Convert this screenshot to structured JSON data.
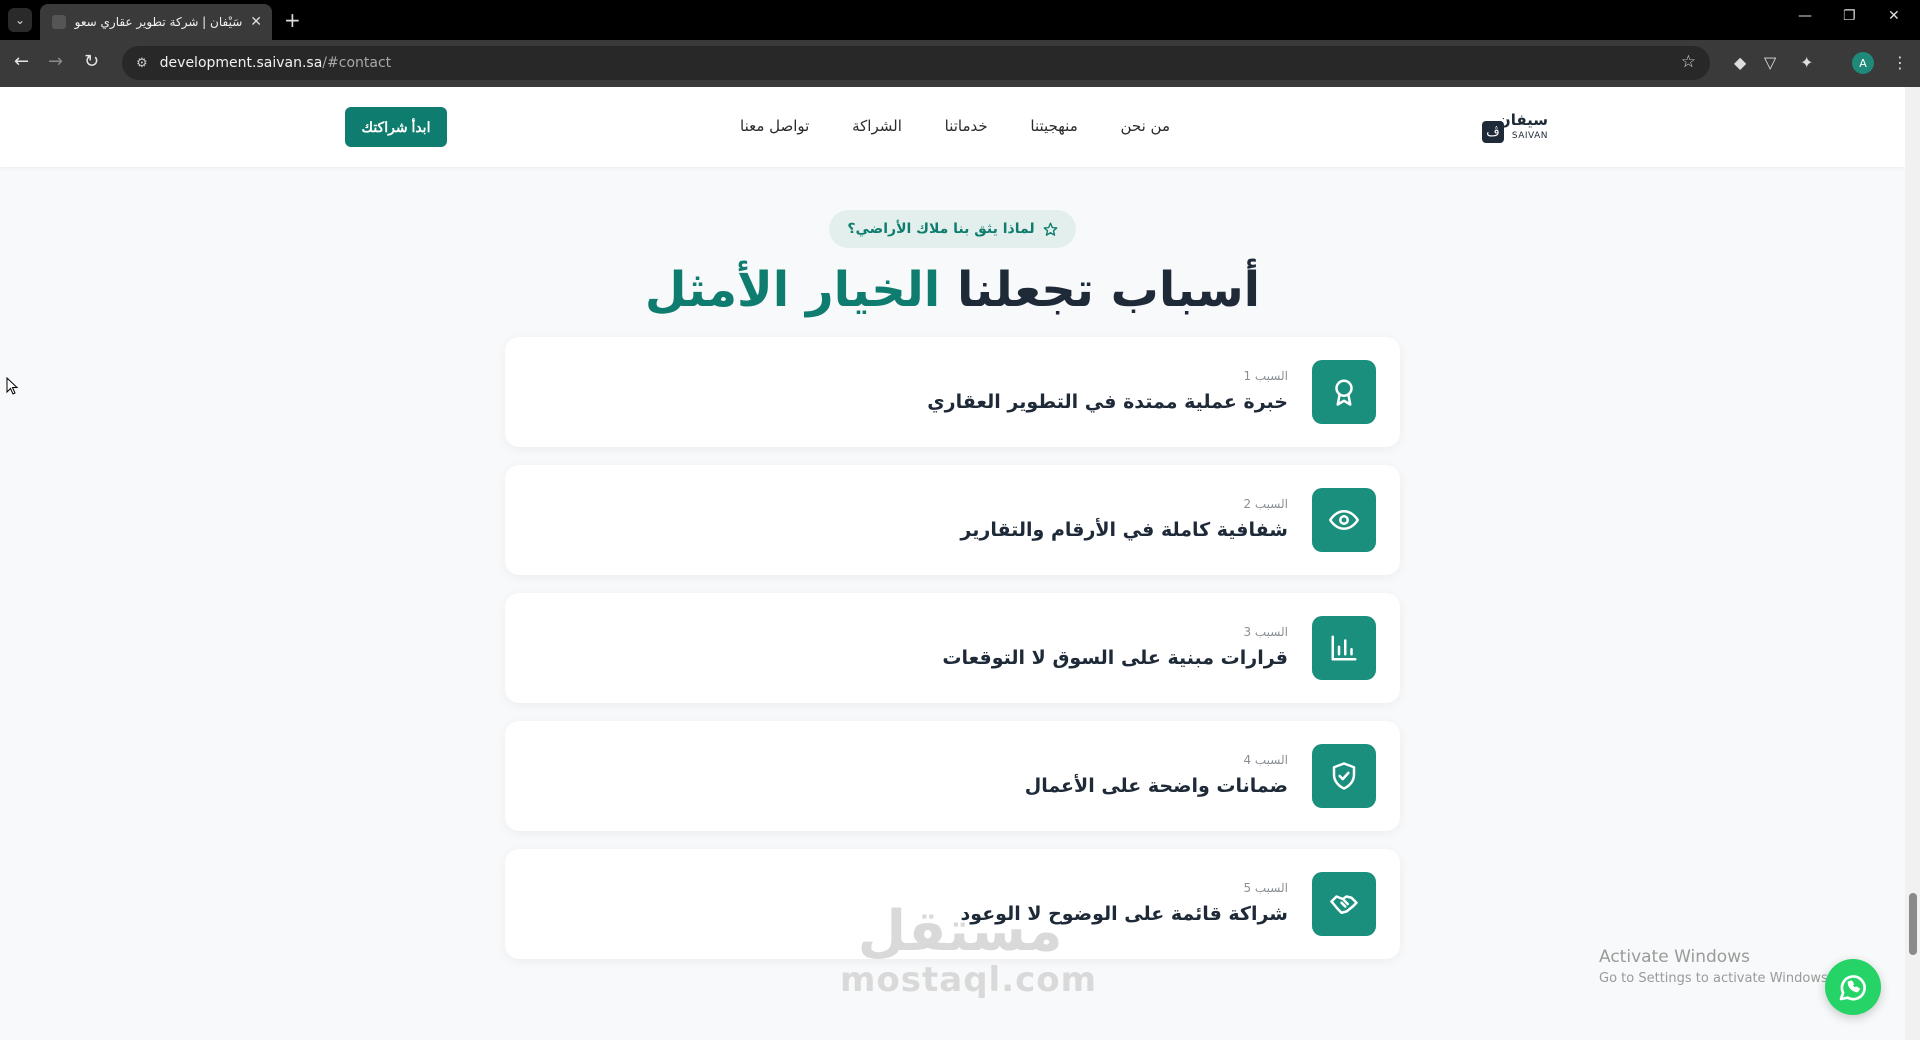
{
  "browser": {
    "tab_title": "سَيْفان | شركة تطوير عقاري سعودي",
    "tab_close": "✕",
    "new_tab": "+",
    "url_host": "development.saivan.sa",
    "url_path": "/#contact",
    "profile_initial": "A",
    "window_controls": [
      "—",
      "❐",
      "✕"
    ]
  },
  "header": {
    "logo_ar": "سيفان",
    "logo_en": "SAIVAN",
    "logo_mark": "ڤ",
    "nav": [
      "من نحن",
      "منهجيتنا",
      "خدماتنا",
      "الشراكة",
      "تواصل معنا"
    ],
    "cta": "ابدأ شراكتك"
  },
  "section": {
    "badge": "لماذا يثق بنا ملاك الأراضي؟",
    "heading_main": "أسباب تجعلنا",
    "heading_accent": "الخيار الأمثل"
  },
  "reasons": [
    {
      "label": "السبب 1",
      "title": "خبرة عملية ممتدة في التطوير العقاري",
      "icon": "award-icon"
    },
    {
      "label": "السبب 2",
      "title": "شفافية كاملة في الأرقام والتقارير",
      "icon": "eye-icon"
    },
    {
      "label": "السبب 3",
      "title": "قرارات مبنية على السوق لا التوقعات",
      "icon": "bar-chart-icon"
    },
    {
      "label": "السبب 4",
      "title": "ضمانات واضحة على الأعمال",
      "icon": "shield-check-icon"
    },
    {
      "label": "السبب 5",
      "title": "شراكة قائمة على الوضوح لا الوعود",
      "icon": "handshake-icon"
    }
  ],
  "watermark": {
    "ar": "مستقل",
    "en": "mostaql.com"
  },
  "os_overlay": {
    "title": "Activate Windows",
    "subtitle": "Go to Settings to activate Windows."
  },
  "colors": {
    "brand": "#0e7c6e",
    "icon_bg": "#1a8f7d",
    "dark": "#1e2a38",
    "whatsapp": "#25d366"
  }
}
